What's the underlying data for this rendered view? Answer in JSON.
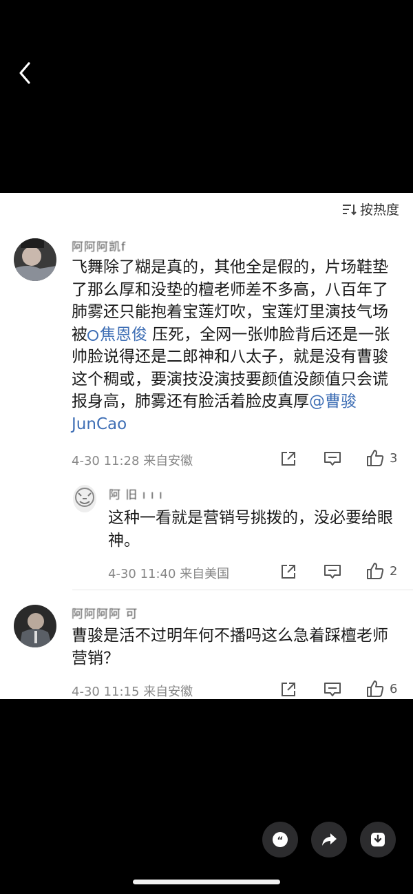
{
  "sort": {
    "label": "按热度",
    "icon": "sort-icon"
  },
  "comments": [
    {
      "username": "阿阿阿凯f",
      "text_part1": "飞舞除了糊是真的，其他全是假的，片场鞋垫了那么厚和没垫的檀老师差不多高，八百年了肺雾还只能抱着宝莲灯吹，宝莲灯里演技气场被",
      "search_link": "焦恩俊",
      "text_part2": " 压死，全网一张帅脸背后还是一张帅脸说得还是二郎神和八太子，就是没有曹骏这个稠或，要演技没演技要颜值没颜值只会谎报身高，肺雾还有脸活着脸皮真厚",
      "mention": "@曹骏JunCao",
      "time": "4-30 11:28",
      "location": "来自安徽",
      "likes": "3",
      "reply": {
        "username": "阿 旧 ı ı ı",
        "text": "这种一看就是营销号挑拨的，没必要给眼神。",
        "time": "4-30 11:40",
        "location": "来自美国",
        "likes": "2"
      }
    },
    {
      "username": "阿阿阿阿 可",
      "text": "曹骏是活不过明年何不播吗这么急着踩檀老师营销？",
      "time": "4-30 11:15",
      "location": "来自安徽",
      "likes": "6"
    }
  ],
  "fab_icons": [
    "quote-icon",
    "share-icon",
    "download-icon"
  ]
}
